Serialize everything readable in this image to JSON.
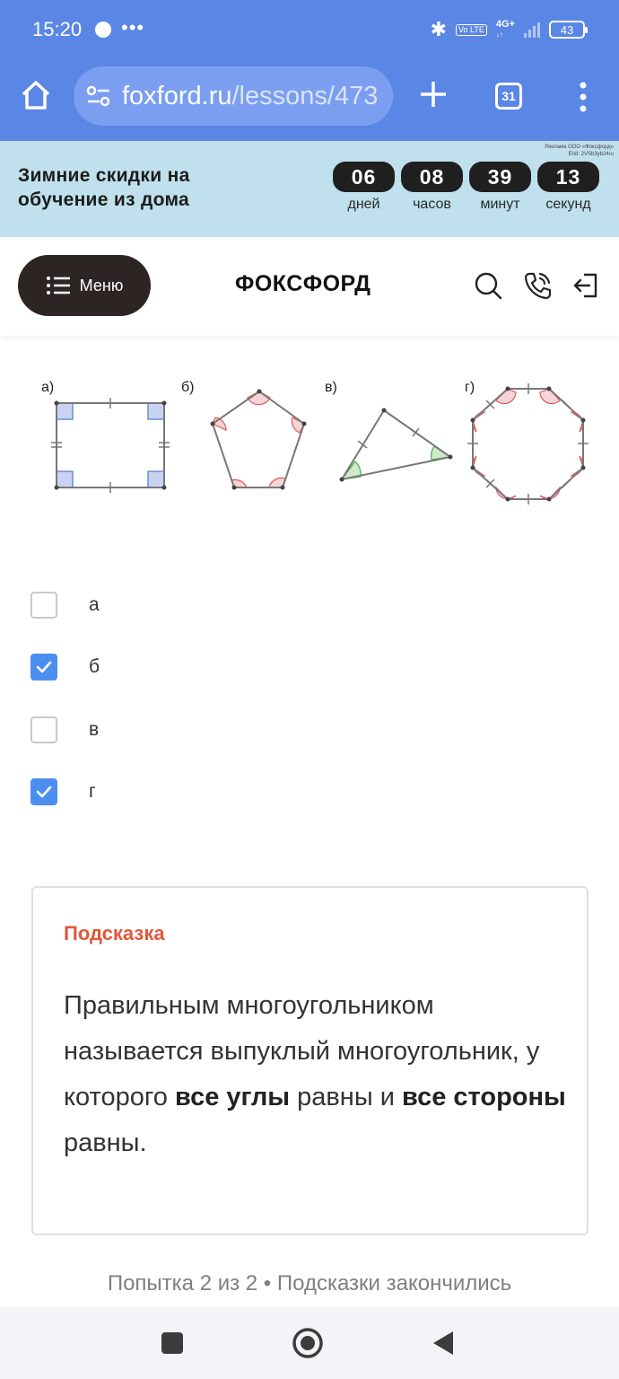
{
  "status_bar": {
    "time": "15:20",
    "more": "•••",
    "network_badge": "Vo LTE",
    "network_type": "4G+",
    "battery": "43"
  },
  "browser": {
    "url_domain": "foxford.ru",
    "url_path": "/lessons/473",
    "tab_count": "31"
  },
  "ad_banner": {
    "legal_line1": "Реклама ООО «Фоксфорд»",
    "legal_line2": "Erid: 2VSb3yb24ru",
    "headline": "Зимние скидки на обучение из дома",
    "countdown": [
      {
        "value": "06",
        "unit": "дней"
      },
      {
        "value": "08",
        "unit": "часов"
      },
      {
        "value": "39",
        "unit": "минут"
      },
      {
        "value": "13",
        "unit": "секунд"
      }
    ]
  },
  "site_header": {
    "menu_label": "Меню",
    "brand": "ФОКСФОРД"
  },
  "figures": {
    "labels": [
      "а)",
      "б)",
      "в)",
      "г)"
    ],
    "colors": {
      "outline": "#777777",
      "blue": "#5b7fd0",
      "red": "#e05a5a",
      "green": "#4fae4f"
    }
  },
  "options": [
    {
      "label": "а",
      "checked": false
    },
    {
      "label": "б",
      "checked": true
    },
    {
      "label": "в",
      "checked": false
    },
    {
      "label": "г",
      "checked": true
    }
  ],
  "hint": {
    "title": "Подсказка",
    "text_part1": "Правильным многоугольником называется выпуклый многоугольник, у которого ",
    "bold1": "все углы",
    "text_part2": " равны и ",
    "bold2": "все стороны",
    "text_part3": " равны."
  },
  "footer": {
    "attempts": "Попытка 2 из 2 • Подсказки закончились"
  },
  "colors": {
    "browser_bar": "#5a86e6",
    "banner": "#bfe0ec",
    "accent_checkbox": "#4a8ff0",
    "hint_title": "#e0573a"
  }
}
